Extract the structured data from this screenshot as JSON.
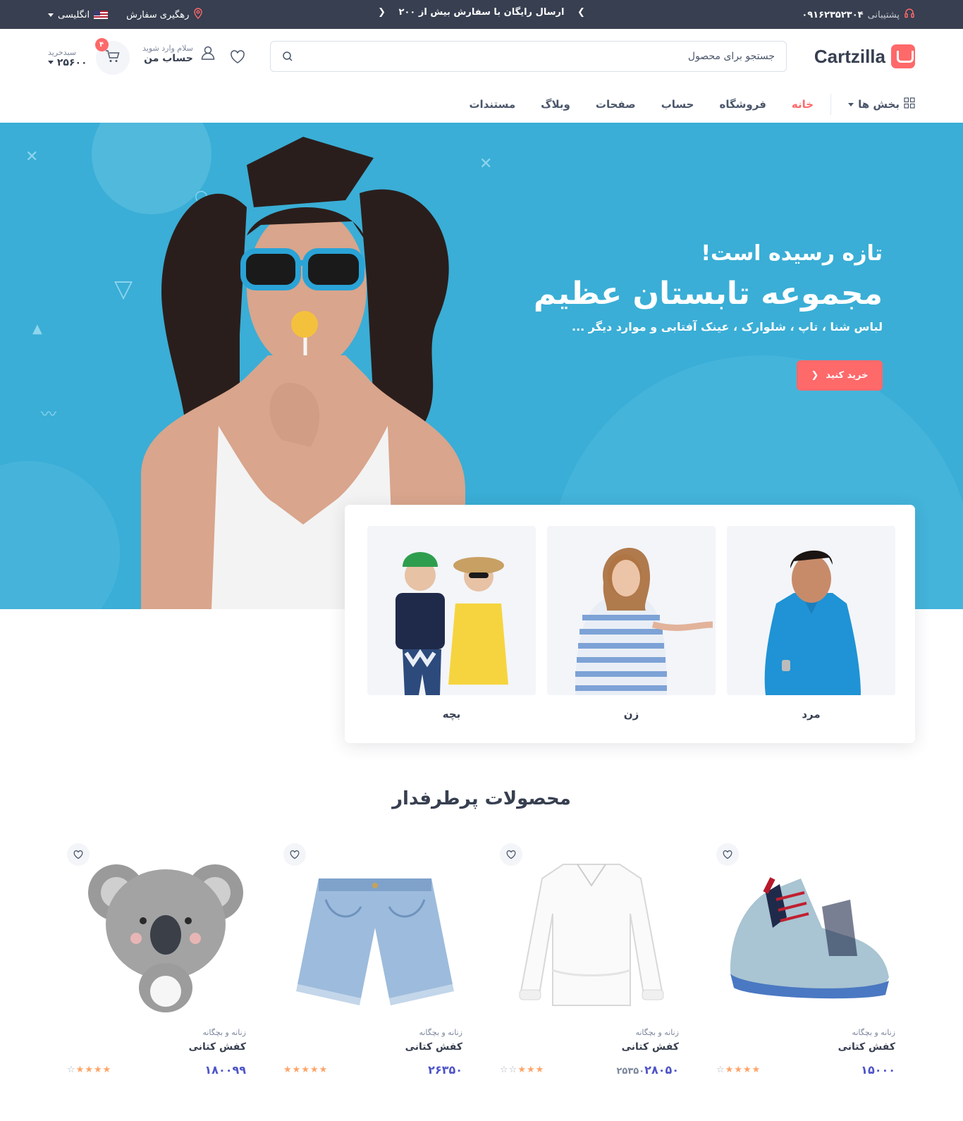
{
  "topbar": {
    "support_label": "پشتیبانی",
    "support_phone": "۰۹۱۶۲۳۵۲۳۰۴",
    "promo": "ارسال رایگان با سفارش بیش از ۲۰۰",
    "tracking": "رهگیری سفارش",
    "language": "انگلیسی"
  },
  "header": {
    "logo": "Cartzilla",
    "search_placeholder": "جستجو برای محصول",
    "account_greeting": "سلام وارد شوید",
    "account_label": "حساب من",
    "cart_label": "سبدخرید",
    "cart_total": "۲۵۶۰۰",
    "cart_count": "۴"
  },
  "menu": {
    "categories": "بخش ها",
    "items": [
      "خانه",
      "فروشگاه",
      "حساب",
      "صفحات",
      "وبلاگ",
      "مستندات"
    ],
    "active_index": 0
  },
  "hero": {
    "eyebrow": "تازه رسیده است!",
    "title": "مجموعه تابستان عظیم",
    "subtitle": "لباس شنا ، تاپ ، شلوارک ، عینک آفتابی و موارد دیگر ...",
    "cta": "خرید کنید"
  },
  "categories": [
    {
      "label": "مرد"
    },
    {
      "label": "زن"
    },
    {
      "label": "بچه"
    }
  ],
  "section_title": "محصولات پرطرفدار",
  "products": [
    {
      "category": "زنانه و بچگانه",
      "name": "کفش کتانی",
      "price": "۱۵۰۰۰",
      "old_price": "",
      "rating": 3.5,
      "image": "sneaker"
    },
    {
      "category": "زنانه و بچگانه",
      "name": "کفش کتانی",
      "price": "۲۸۰۵۰",
      "old_price": "۲۵۳۵۰",
      "rating": 3,
      "image": "blouse"
    },
    {
      "category": "زنانه و بچگانه",
      "name": "کفش کتانی",
      "price": "۲۶۳۵۰",
      "old_price": "",
      "rating": 5,
      "image": "shorts"
    },
    {
      "category": "زنانه و بچگانه",
      "name": "کفش کتانی",
      "price": "۱۸۰۰۹۹",
      "old_price": "",
      "rating": 4,
      "image": "koala"
    }
  ],
  "colors": {
    "accent": "#fe696a",
    "hero_bg": "#3aaed6",
    "topbar_bg": "#373f50",
    "price": "#4e54c8",
    "star": "#fea569"
  }
}
